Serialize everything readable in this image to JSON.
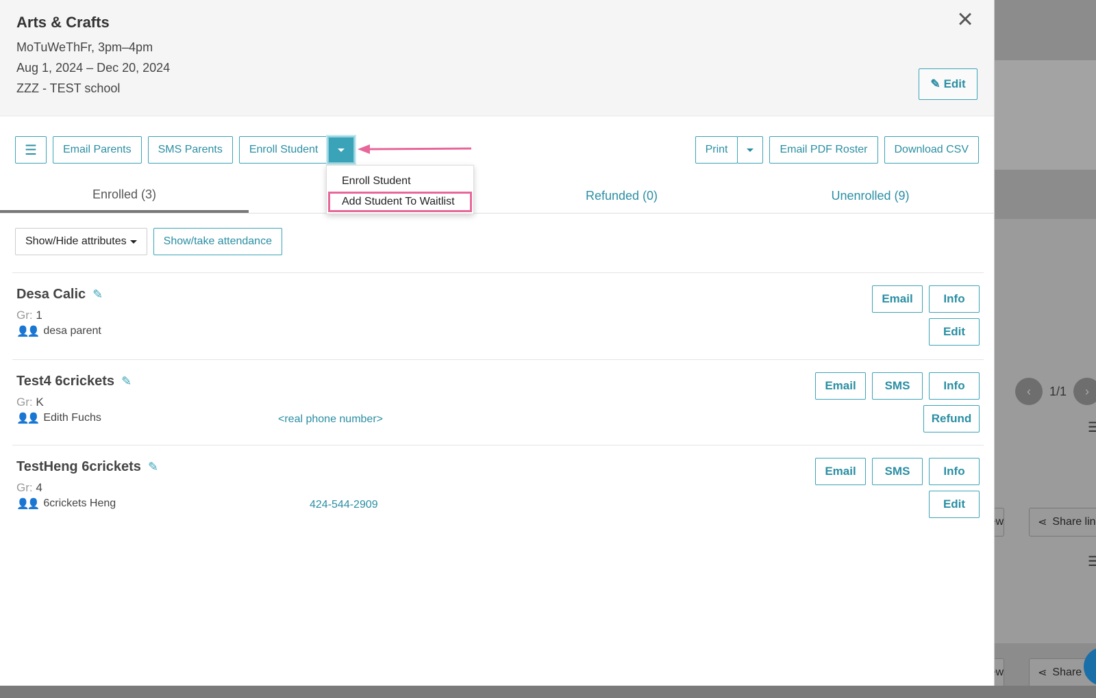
{
  "course": {
    "title": "Arts & Crafts",
    "schedule": "MoTuWeThFr, 3pm–4pm",
    "dates": "Aug 1, 2024 – Dec 20, 2024",
    "school": "ZZZ - TEST school",
    "edit_label": "Edit"
  },
  "toolbar": {
    "email_parents": "Email Parents",
    "sms_parents": "SMS Parents",
    "enroll_student": "Enroll Student",
    "print": "Print",
    "email_pdf_roster": "Email PDF Roster",
    "download_csv": "Download CSV"
  },
  "enroll_menu": {
    "items": [
      {
        "label": "Enroll Student"
      },
      {
        "label": "Add Student To Waitlist",
        "highlighted": true
      }
    ]
  },
  "tabs": [
    {
      "label": "Enrolled (3)",
      "active": true
    },
    {
      "label": "Refunded (0)"
    },
    {
      "label": "Unenrolled (9)"
    }
  ],
  "filters": {
    "show_hide": "Show/Hide attributes",
    "attendance": "Show/take attendance"
  },
  "grade_label": "Gr:",
  "students": [
    {
      "name": "Desa Calic",
      "grade": "1",
      "parent": "desa parent",
      "phone": "",
      "actions": [
        "Email",
        "Info"
      ],
      "actions2": [
        "Edit"
      ]
    },
    {
      "name": "Test4 6crickets",
      "grade": "K",
      "parent": "Edith Fuchs",
      "phone": "<real phone number>",
      "actions": [
        "Email",
        "SMS",
        "Info"
      ],
      "actions2": [
        "Refund"
      ]
    },
    {
      "name": "TestHeng 6crickets",
      "grade": "4",
      "parent": "6crickets Heng",
      "phone": "424-544-2909",
      "actions": [
        "Email",
        "SMS",
        "Info"
      ],
      "actions2": [
        "Edit"
      ]
    }
  ],
  "background": {
    "pager": "1/1",
    "view_label": "view",
    "share_label_1": "Share lin",
    "share_label_2": "Share l"
  },
  "colors": {
    "accent": "#3aa3b8",
    "highlight": "#e8679a"
  }
}
